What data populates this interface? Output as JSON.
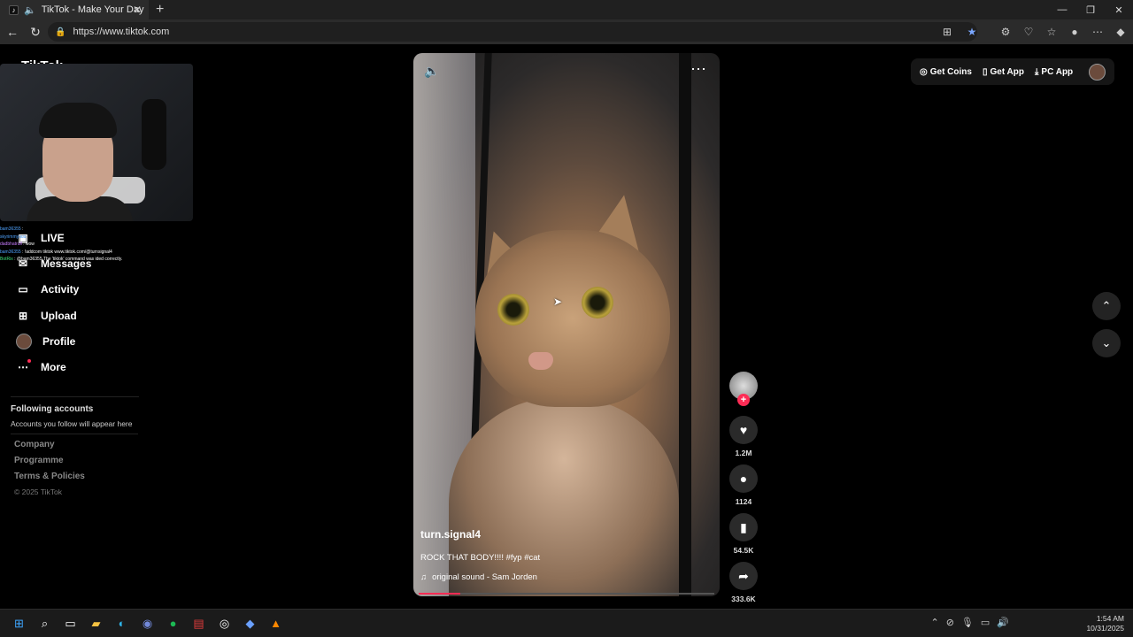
{
  "browser": {
    "tab_title": "TikTok - Make Your Day",
    "tab_favicon": "♪",
    "new_tab": "+",
    "url": "https://www.tiktok.com",
    "window_controls": [
      "—",
      "❐",
      "✕"
    ]
  },
  "sidebar": {
    "logo": "TikTok",
    "nav_items": [
      {
        "label": "LIVE",
        "icon": "live-icon"
      },
      {
        "label": "Messages",
        "icon": "messages-icon"
      },
      {
        "label": "Activity",
        "icon": "activity-icon"
      },
      {
        "label": "Upload",
        "icon": "upload-icon"
      },
      {
        "label": "Profile",
        "icon": "profile-avatar"
      },
      {
        "label": "More",
        "icon": "more-icon"
      }
    ],
    "following_title": "Following accounts",
    "following_text": "Accounts you follow will appear here",
    "footer_links": [
      "Company",
      "Programme",
      "Terms & Policies"
    ],
    "copyright": "© 2025 TikTok"
  },
  "overlay_chat": [
    {
      "user": "bam36355",
      "text": ":"
    },
    {
      "user": "skyrimmyuuu",
      "text": ""
    },
    {
      "user": "dadbhatrull",
      "text": ": wow"
    },
    {
      "user": "bam36355",
      "text": ": !addcom tiktok www.tiktok.com/@turnsignal4"
    },
    {
      "user": "BotRix",
      "text": ": @bam36355 The 'tiktok' command was ided correctly."
    }
  ],
  "video": {
    "author": "turn.signal4",
    "description": "ROCK THAT BODY!!!! #fyp #cat",
    "sound": "original sound - Sam Jorden",
    "progress": 0.14
  },
  "actions": {
    "likes": "1.2M",
    "comments": "1124",
    "saves": "54.5K",
    "shares": "333.6K"
  },
  "header": {
    "get_coins": "Get Coins",
    "get_app": "Get App",
    "pc_app": "PC App"
  },
  "taskbar": {
    "time": "1:54 AM",
    "date": "10/31/2025"
  },
  "colors": {
    "accent": "#fe2c55",
    "background": "#000000"
  }
}
